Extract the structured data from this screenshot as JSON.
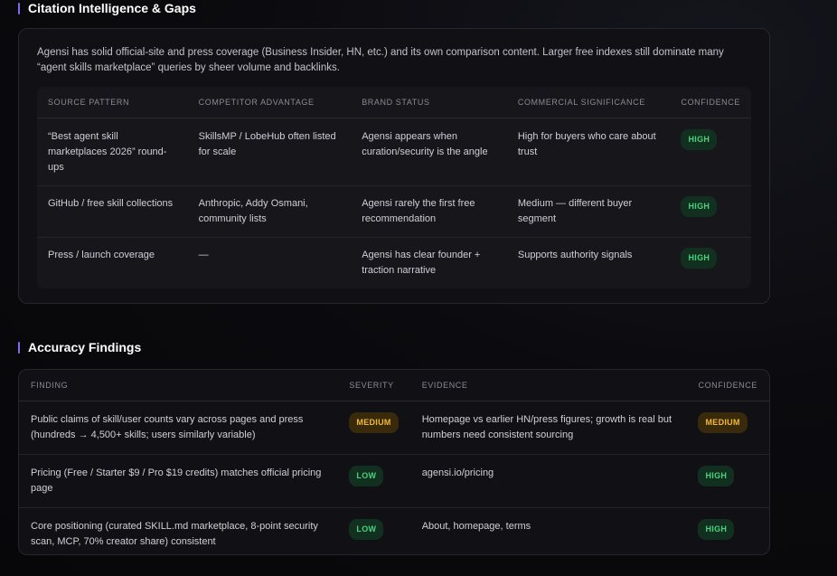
{
  "citation": {
    "title": "Citation Intelligence & Gaps",
    "intro": "Agensi has solid official-site and press coverage (Business Insider, HN, etc.) and its own comparison content. Larger free indexes still dominate many “agent skills marketplace” queries by sheer volume and backlinks.",
    "headers": [
      "SOURCE PATTERN",
      "COMPETITOR ADVANTAGE",
      "BRAND STATUS",
      "COMMERCIAL SIGNIFICANCE",
      "CONFIDENCE"
    ],
    "rows": [
      {
        "source": "“Best agent skill marketplaces 2026” round-ups",
        "competitor": "SkillsMP / LobeHub often listed for scale",
        "brand": "Agensi appears when curation/security is the angle",
        "commercial": "High for buyers who care about trust",
        "confidence": "HIGH"
      },
      {
        "source": "GitHub / free skill collections",
        "competitor": "Anthropic, Addy Osmani, community lists",
        "brand": "Agensi rarely the first free recommendation",
        "commercial": "Medium — different buyer segment",
        "confidence": "HIGH"
      },
      {
        "source": "Press / launch coverage",
        "competitor": "—",
        "brand": "Agensi has clear founder + traction narrative",
        "commercial": "Supports authority signals",
        "confidence": "HIGH"
      }
    ]
  },
  "accuracy": {
    "title": "Accuracy Findings",
    "headers": [
      "FINDING",
      "SEVERITY",
      "EVIDENCE",
      "CONFIDENCE"
    ],
    "rows": [
      {
        "finding": "Public claims of skill/user counts vary across pages and press (hundreds → 4,500+ skills; users similarly variable)",
        "severity": "MEDIUM",
        "evidence": "Homepage vs earlier HN/press figures; growth is real but numbers need consistent sourcing",
        "confidence": "MEDIUM"
      },
      {
        "finding": "Pricing (Free / Starter $9 / Pro $19 credits) matches official pricing page",
        "severity": "LOW",
        "evidence": "agensi.io/pricing",
        "confidence": "HIGH"
      },
      {
        "finding": "Core positioning (curated SKILL.md marketplace, 8-point security scan, MCP, 70% creator share) consistent",
        "severity": "LOW",
        "evidence": "About, homepage, terms",
        "confidence": "HIGH"
      }
    ]
  },
  "colors": {
    "accent": "#7c6cf0",
    "badge_high_bg": "#12301f",
    "badge_high_fg": "#4ad27f",
    "badge_medium_bg": "#3a2a0c",
    "badge_medium_fg": "#f0b93a"
  }
}
